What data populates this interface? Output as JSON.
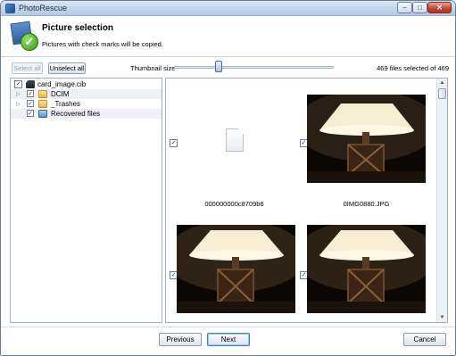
{
  "window": {
    "title": "PhotoRescue",
    "controls": {
      "minimize": "‒",
      "maximize": "□",
      "close": "✕"
    }
  },
  "header": {
    "heading": "Picture selection",
    "subheading": "Pictures with check marks will be copied."
  },
  "toolbar": {
    "select_all_label": "Select all",
    "select_all_enabled": false,
    "unselect_all_label": "Unselect all",
    "thumbnail_size_label": "Thumbnail size",
    "thumbnail_size_value_pct": 27,
    "selection_count": "469 files selected of 469"
  },
  "tree": {
    "items": [
      {
        "label": "card_image.cib",
        "checked": true,
        "icon": "memory-card-icon",
        "level": 0,
        "expandable": false
      },
      {
        "label": "DCIM",
        "checked": true,
        "icon": "folder-icon",
        "level": 1,
        "expandable": true
      },
      {
        "label": "_Trashes",
        "checked": true,
        "icon": "folder-icon",
        "level": 1,
        "expandable": true
      },
      {
        "label": "Recovered files",
        "checked": true,
        "icon": "recycle-folder-icon",
        "level": 1,
        "expandable": false
      }
    ]
  },
  "thumbnails": {
    "items": [
      {
        "caption": "000000000c8709b6",
        "kind": "generic-file",
        "checked": true
      },
      {
        "caption": "0IMG0880.JPG",
        "kind": "lamp-photo",
        "checked": true
      },
      {
        "caption": "",
        "kind": "lamp-photo",
        "checked": true
      },
      {
        "caption": "",
        "kind": "lamp-photo",
        "checked": true
      }
    ]
  },
  "footer": {
    "previous_label": "Previous",
    "next_label": "Next",
    "cancel_label": "Cancel"
  },
  "glyphs": {
    "check": "✓",
    "expand": "▷",
    "scroll_up": "▲",
    "scroll_down": "▼"
  }
}
